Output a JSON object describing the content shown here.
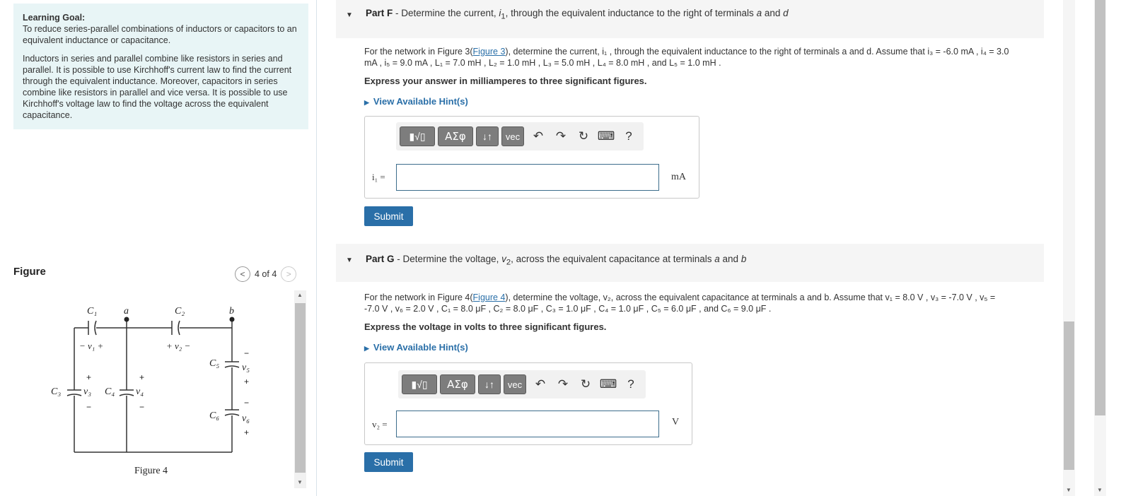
{
  "goal": {
    "title": "Learning Goal:",
    "intro": "To reduce series-parallel combinations of inductors or capacitors to an equivalent inductance or capacitance.",
    "body": "Inductors in series and parallel combine like resistors in series and parallel.  It is possible to use Kirchhoff's current law to find the current through the equivalent inductance. Moreover, capacitors in series combine like resistors in parallel and vice versa.  It is possible to use Kirchhoff's voltage law to find the voltage across the equivalent capacitance."
  },
  "figure": {
    "label": "Figure",
    "count": "4 of 4",
    "prev_icon": "chevron-left-icon",
    "next_icon": "chevron-right-icon",
    "caption": "Figure 4",
    "labels": {
      "C1": "C₁",
      "C2": "C₂",
      "C3": "C₃",
      "C4": "C₄",
      "C5": "C₅",
      "C6": "C₆",
      "a": "a",
      "b": "b",
      "v1": "− v₁ +",
      "v2": "+ v₂ −",
      "v3": "v₃",
      "v4": "v₄",
      "v5": "v₅",
      "v6": "v₆",
      "plus": "+",
      "minus": "−"
    }
  },
  "partF": {
    "label": "Part F",
    "title_pre": " - Determine the current, ",
    "title_var": "i",
    "title_sub": "1",
    "title_post": ", through the equivalent inductance to the right of terminals ",
    "title_a": "a",
    "title_and": " and ",
    "title_d": "d",
    "para_line1_pre": "For the network in Figure 3(",
    "para_link": "Figure 3",
    "para_line1_post": "), determine the current, i₁ , through the equivalent inductance to the right of terminals a and d. Assume that i₃ = -6.0 mA , i₄ = 3.0",
    "para_line2": "mA , i₅ = 9.0 mA , L₁ = 7.0 mH , L₂ = 1.0 mH , L₃ = 5.0 mH , L₄ = 8.0 mH , and L₅ = 1.0 mH .",
    "instruction": "Express your answer in milliamperes to three significant figures.",
    "hint": "View Available Hint(s)",
    "answer_label": "i₁ =",
    "answer_value": "",
    "unit": "mA",
    "submit": "Submit"
  },
  "partG": {
    "label": "Part G",
    "title_pre": " - Determine the voltage, ",
    "title_var": "v",
    "title_sub": "2",
    "title_post": ", across the equivalent capacitance at terminals ",
    "title_a": "a",
    "title_and": " and ",
    "title_b": "b",
    "para_line1_pre": "For the network in Figure 4(",
    "para_link": "Figure 4",
    "para_line1_post": "), determine the voltage, v₂, across the equivalent capacitance at terminals a and b. Assume that v₁ = 8.0 V , v₃ = -7.0 V , v₅ =",
    "para_line2": "-7.0 V , v₆ = 2.0 V , C₁ = 8.0 μF , C₂ = 8.0 μF , C₃ = 1.0 μF , C₄ = 1.0 μF , C₅ = 6.0 μF , and C₆ = 9.0 μF .",
    "instruction": "Express the voltage in volts to three significant figures.",
    "hint": "View Available Hint(s)",
    "answer_label": "v₂ =",
    "answer_value": "",
    "unit": "V",
    "submit": "Submit"
  },
  "toolbar": {
    "greek": "ΑΣφ",
    "arrows": "↓↑",
    "vec": "vec",
    "help": "?"
  }
}
